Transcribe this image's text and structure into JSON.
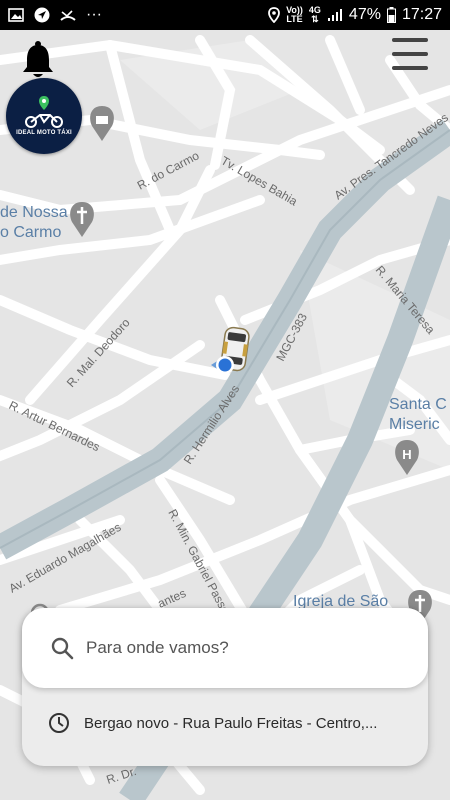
{
  "status_bar": {
    "left_icons": [
      "image-icon",
      "navigation-icon",
      "missed-call-icon",
      "more-dots-icon"
    ],
    "more_dots": "···",
    "volte_top": "Vo))",
    "volte_bottom": "LTE",
    "network_type": "4G",
    "battery_percent": "47%",
    "time": "17:27"
  },
  "header": {
    "bell_icon": "bell-icon",
    "logo_name": "IDEAL MOTO TÁXI",
    "menu_icon": "hamburger-menu-icon"
  },
  "map": {
    "street_labels": [
      "R. do Carmo",
      "Tv. Lopes Bahia",
      "Av. Pres. Tancredo Neves",
      "R. Maria Teresa",
      "R. Mal. Deodoro",
      "MGC-383",
      "R. Artur Bernardes",
      "R. Hermilio Alves",
      "Av. Eduardo Magalhães",
      "R. Min. Gabriel Passos",
      "antes",
      "R. Dr."
    ],
    "poi_labels": [
      "de Nossa",
      "o Carmo",
      "Santa C",
      "Miseric",
      "Igreja de São"
    ],
    "marker_icon": "car-marker-icon",
    "location_icon": "my-location-dot-icon"
  },
  "search_card": {
    "search_icon": "search-icon",
    "search_placeholder": "Para onde vamos?",
    "recent_icon": "clock-icon",
    "recent_address": "Bergao novo - Rua Paulo Freitas - Centro,..."
  }
}
